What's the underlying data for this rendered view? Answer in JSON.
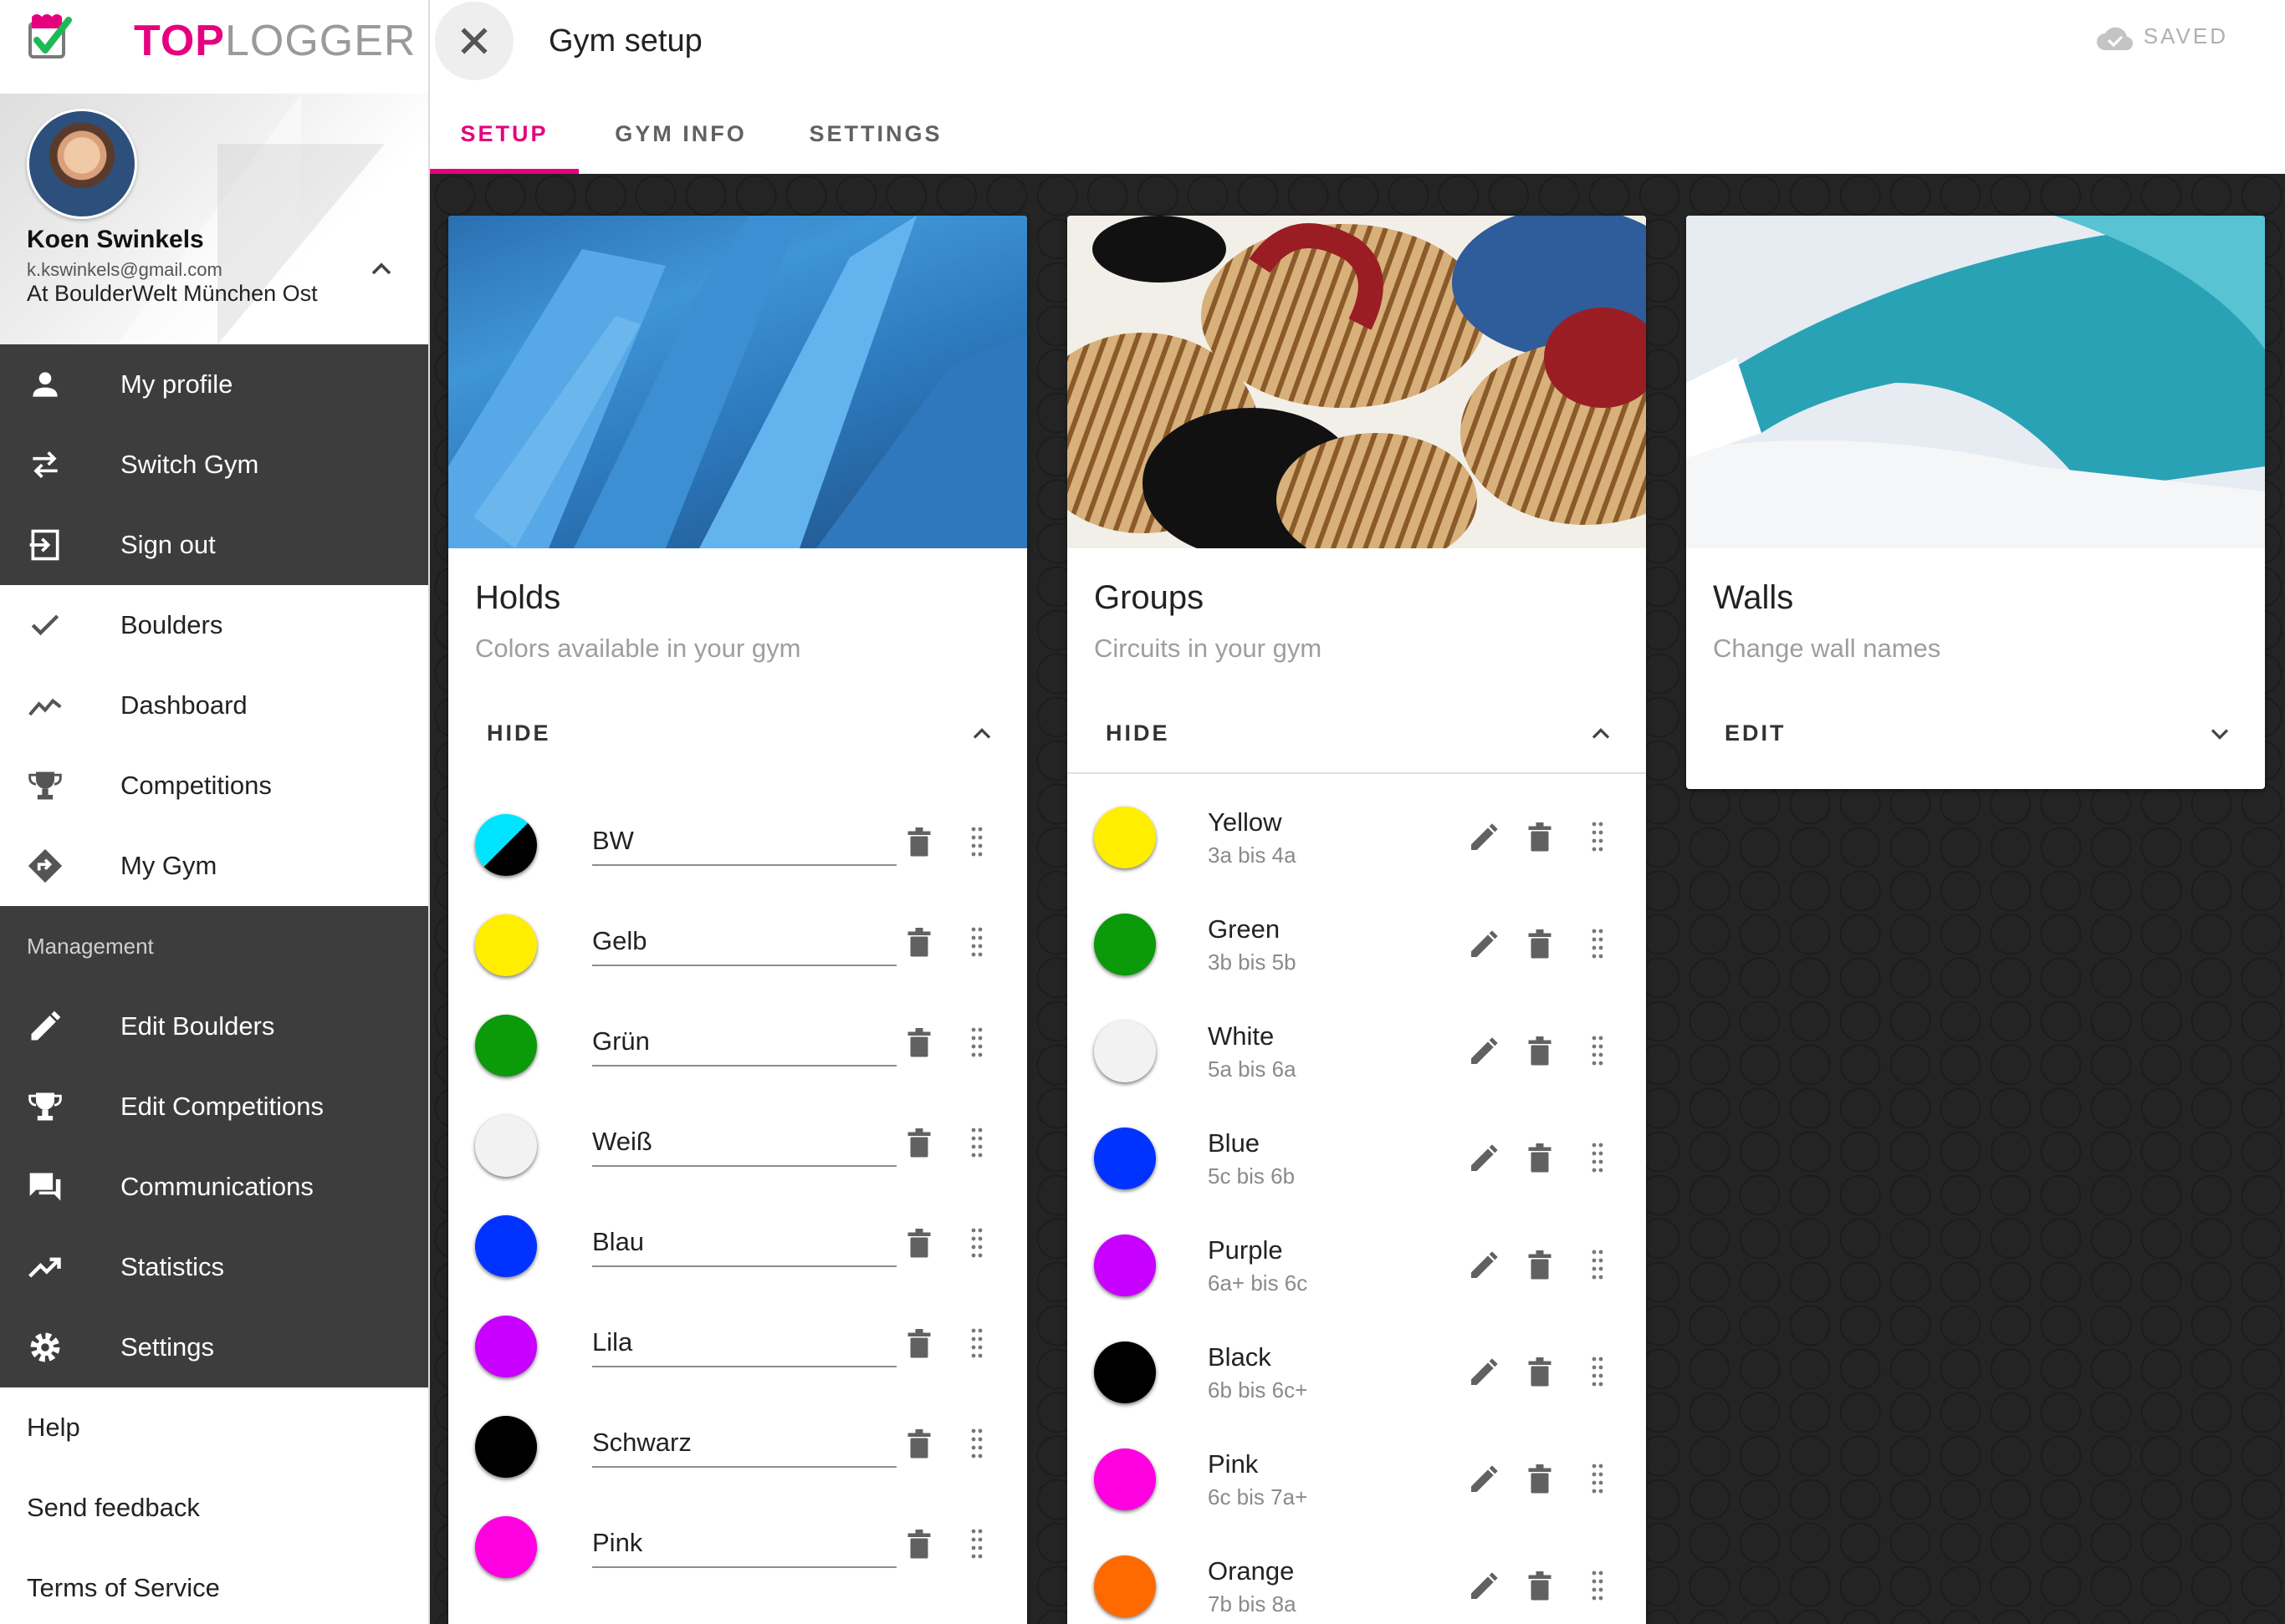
{
  "app": {
    "logo_top": "TOP",
    "logo_logger": "LOGGER",
    "brand_color": "#e6007e"
  },
  "profile": {
    "name": "Koen Swinkels",
    "email": "k.kswinkels@gmail.com",
    "gym": "At BoulderWelt München Ost"
  },
  "sidebar": {
    "account_items": [
      {
        "label": "My profile",
        "icon": "person-icon"
      },
      {
        "label": "Switch Gym",
        "icon": "swap-icon"
      },
      {
        "label": "Sign out",
        "icon": "sign-out-icon"
      }
    ],
    "main_items": [
      {
        "label": "Boulders",
        "icon": "check-icon"
      },
      {
        "label": "Dashboard",
        "icon": "chart-line-icon"
      },
      {
        "label": "Competitions",
        "icon": "trophy-icon"
      },
      {
        "label": "My Gym",
        "icon": "directions-icon"
      }
    ],
    "management_label": "Management",
    "management_items": [
      {
        "label": "Edit Boulders",
        "icon": "pencil-icon"
      },
      {
        "label": "Edit Competitions",
        "icon": "trophy-edit-icon"
      },
      {
        "label": "Communications",
        "icon": "chat-icon"
      },
      {
        "label": "Statistics",
        "icon": "trending-up-icon"
      },
      {
        "label": "Settings",
        "icon": "gear-icon"
      }
    ],
    "footer_items": [
      {
        "label": "Help"
      },
      {
        "label": "Send feedback"
      },
      {
        "label": "Terms of Service"
      }
    ]
  },
  "header": {
    "title": "Gym setup",
    "status": "SAVED",
    "tabs": [
      {
        "label": "SETUP",
        "active": true
      },
      {
        "label": "GYM INFO",
        "active": false
      },
      {
        "label": "SETTINGS",
        "active": false
      }
    ]
  },
  "cards": {
    "holds": {
      "title": "Holds",
      "subtitle": "Colors available in your gym",
      "action": "HIDE"
    },
    "groups": {
      "title": "Groups",
      "subtitle": "Circuits in your gym",
      "action": "HIDE"
    },
    "walls": {
      "title": "Walls",
      "subtitle": "Change wall names",
      "action": "EDIT"
    }
  },
  "holds": [
    {
      "name": "BW",
      "color": "#000000",
      "color2": "#00e5ff"
    },
    {
      "name": "Gelb",
      "color": "#ffee00"
    },
    {
      "name": "Grün",
      "color": "#0a9a0a"
    },
    {
      "name": "Weiß",
      "color": "#f2f2f2"
    },
    {
      "name": "Blau",
      "color": "#0033ff"
    },
    {
      "name": "Lila",
      "color": "#c800ff"
    },
    {
      "name": "Schwarz",
      "color": "#000000"
    },
    {
      "name": "Pink",
      "color": "#ff00e0"
    }
  ],
  "groups": [
    {
      "name": "Yellow",
      "range": "3a bis 4a",
      "color": "#ffee00"
    },
    {
      "name": "Green",
      "range": "3b bis 5b",
      "color": "#0a9a0a"
    },
    {
      "name": "White",
      "range": "5a bis 6a",
      "color": "#f2f2f2"
    },
    {
      "name": "Blue",
      "range": "5c bis 6b",
      "color": "#0033ff"
    },
    {
      "name": "Purple",
      "range": "6a+ bis 6c",
      "color": "#c800ff"
    },
    {
      "name": "Black",
      "range": "6b bis 6c+",
      "color": "#000000"
    },
    {
      "name": "Pink",
      "range": "6c bis 7a+",
      "color": "#ff00e0"
    },
    {
      "name": "Orange",
      "range": "7b bis 8a",
      "color": "#ff6a00"
    }
  ]
}
